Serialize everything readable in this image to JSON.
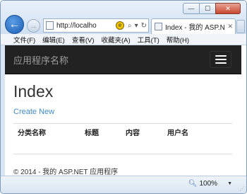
{
  "browser": {
    "window_controls": {
      "minimize": "—",
      "maximize": "☐",
      "close": "✕"
    },
    "back_glyph": "←",
    "forward_glyph": "→",
    "address": "http://localho",
    "compat_glyph": "e",
    "search_glyph": "⌕",
    "dropdown_glyph": "▾",
    "refresh_glyph": "↻",
    "tab_title": "Index - 我的 ASP.NE",
    "tab_close": "✕",
    "menu": [
      "文件(F)",
      "编辑(E)",
      "查看(V)",
      "收藏夹(A)",
      "工具(T)",
      "帮助(H)"
    ],
    "zoom": "100%",
    "zoom_caret": "▼"
  },
  "page": {
    "brand": "应用程序名称",
    "title": "Index",
    "create_link": "Create New",
    "columns": [
      "分类名称",
      "标题",
      "内容",
      "用户名"
    ],
    "footer": "© 2014 - 我的 ASP.NET 应用程序"
  },
  "colors": {
    "navbar": "#222222",
    "brand_text": "#9d9d9d",
    "link": "#428bca"
  }
}
